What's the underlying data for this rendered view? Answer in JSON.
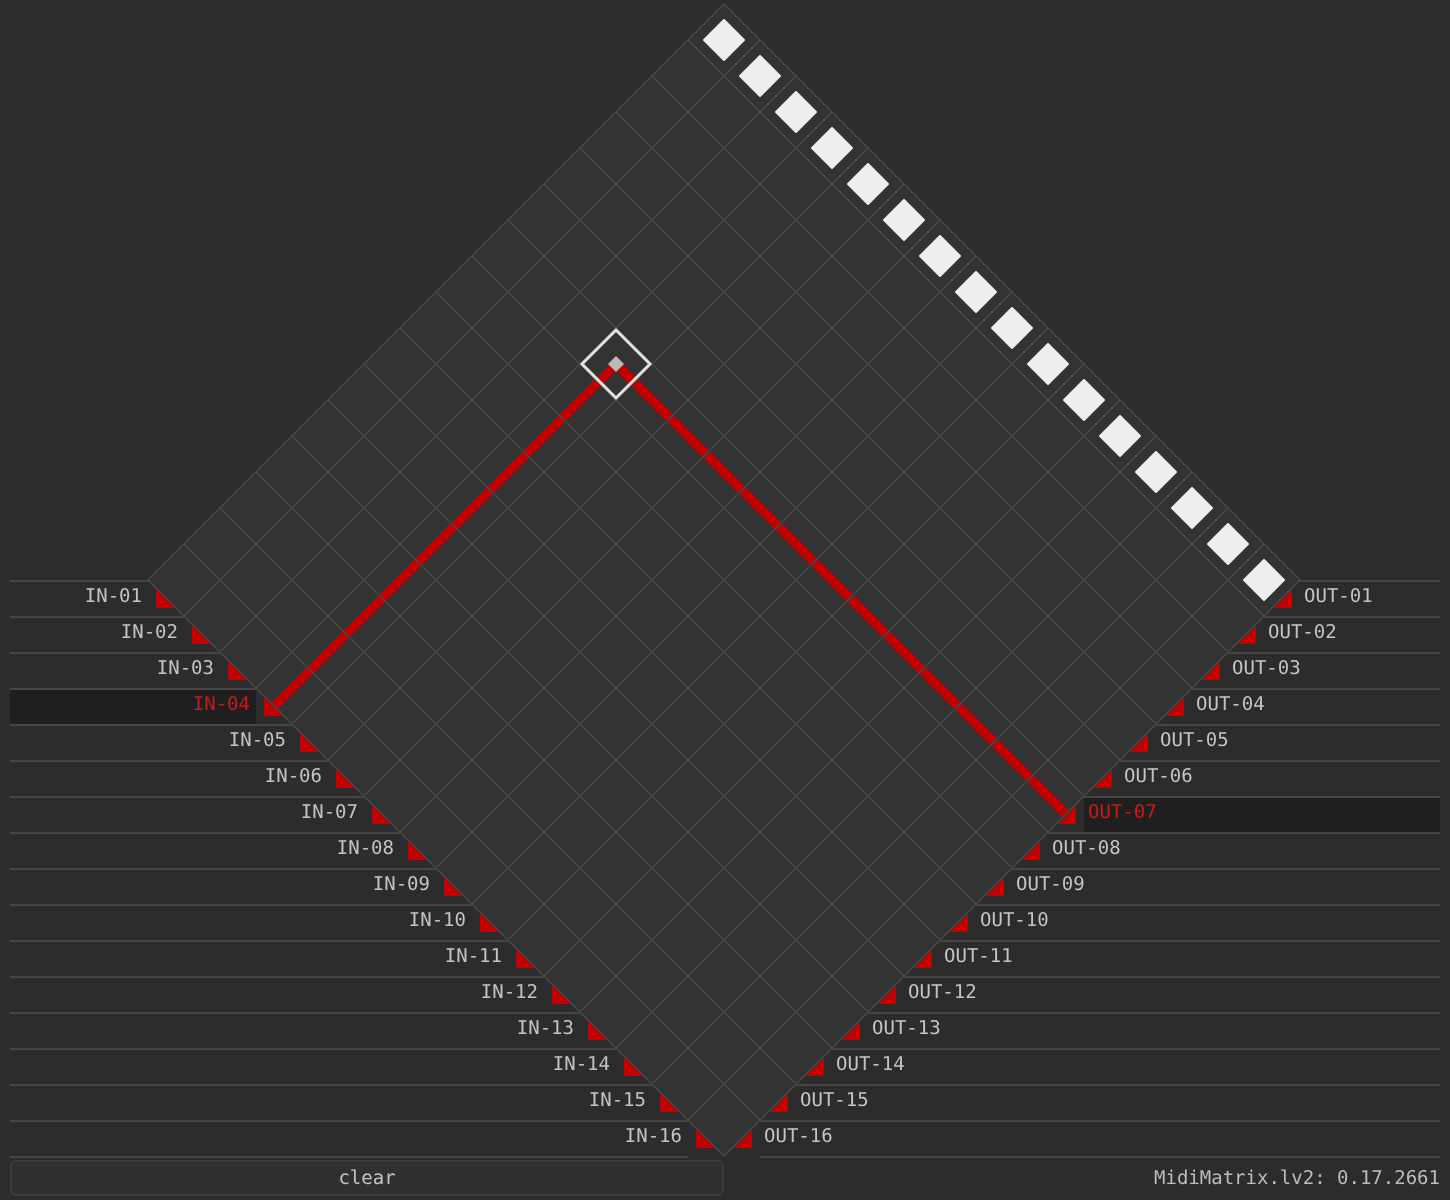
{
  "inputs": [
    {
      "label": "IN-01",
      "selected": false,
      "active": true
    },
    {
      "label": "IN-02",
      "selected": false,
      "active": true
    },
    {
      "label": "IN-03",
      "selected": false,
      "active": true
    },
    {
      "label": "IN-04",
      "selected": true,
      "active": true
    },
    {
      "label": "IN-05",
      "selected": false,
      "active": true
    },
    {
      "label": "IN-06",
      "selected": false,
      "active": true
    },
    {
      "label": "IN-07",
      "selected": false,
      "active": true
    },
    {
      "label": "IN-08",
      "selected": false,
      "active": true
    },
    {
      "label": "IN-09",
      "selected": false,
      "active": true
    },
    {
      "label": "IN-10",
      "selected": false,
      "active": true
    },
    {
      "label": "IN-11",
      "selected": false,
      "active": true
    },
    {
      "label": "IN-12",
      "selected": false,
      "active": true
    },
    {
      "label": "IN-13",
      "selected": false,
      "active": true
    },
    {
      "label": "IN-14",
      "selected": false,
      "active": true
    },
    {
      "label": "IN-15",
      "selected": false,
      "active": true
    },
    {
      "label": "IN-16",
      "selected": false,
      "active": true
    }
  ],
  "outputs": [
    {
      "label": "OUT-01",
      "selected": false
    },
    {
      "label": "OUT-02",
      "selected": false
    },
    {
      "label": "OUT-03",
      "selected": false
    },
    {
      "label": "OUT-04",
      "selected": false
    },
    {
      "label": "OUT-05",
      "selected": false
    },
    {
      "label": "OUT-06",
      "selected": false
    },
    {
      "label": "OUT-07",
      "selected": true
    },
    {
      "label": "OUT-08",
      "selected": false
    },
    {
      "label": "OUT-09",
      "selected": false
    },
    {
      "label": "OUT-10",
      "selected": false
    },
    {
      "label": "OUT-11",
      "selected": false
    },
    {
      "label": "OUT-12",
      "selected": false
    },
    {
      "label": "OUT-13",
      "selected": false
    },
    {
      "label": "OUT-14",
      "selected": false
    },
    {
      "label": "OUT-15",
      "selected": false
    },
    {
      "label": "OUT-16",
      "selected": false
    }
  ],
  "clear_button": {
    "label": "clear"
  },
  "version": "MidiMatrix.lv2: 0.17.2661"
}
